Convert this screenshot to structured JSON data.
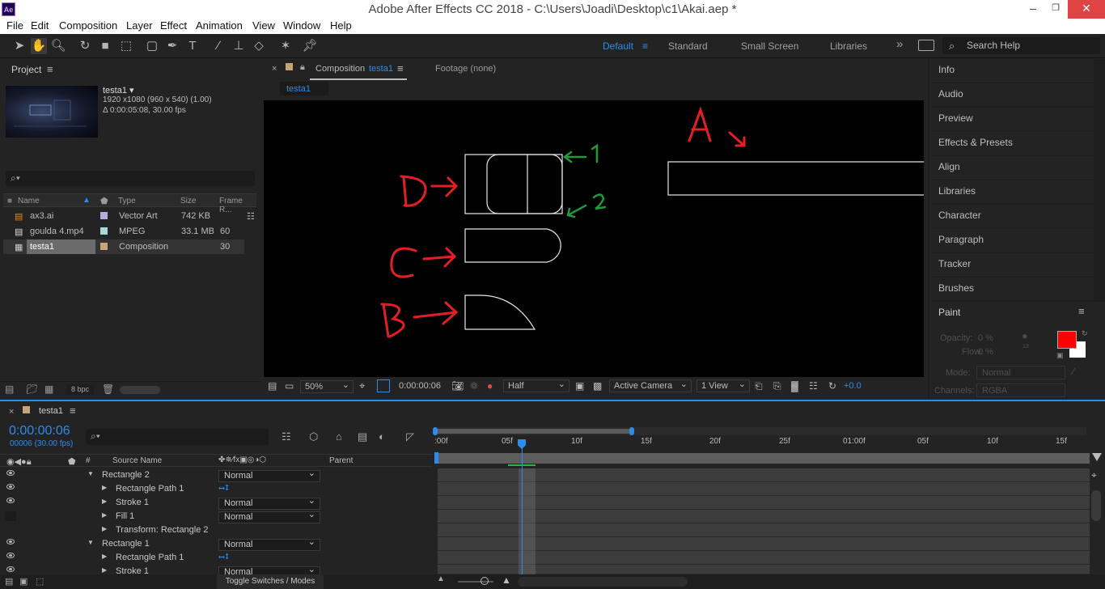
{
  "window": {
    "title": "Adobe After Effects CC 2018 - C:\\Users\\Joadi\\Desktop\\c1\\Akai.aep *",
    "app_icon": "Ae",
    "minimize": "–",
    "maximize": "❐",
    "close": "✕"
  },
  "menu": [
    "File",
    "Edit",
    "Composition",
    "Layer",
    "Effect",
    "Animation",
    "View",
    "Window",
    "Help"
  ],
  "workspaces": {
    "default": "Default",
    "standard": "Standard",
    "small": "Small Screen",
    "libraries": "Libraries",
    "more": "»"
  },
  "search_help": "Search Help",
  "project": {
    "title": "Project",
    "item_name": "testa1 ▾",
    "item_res": "1920 x1080  (960 x 540) (1.00)",
    "item_dur": "Δ 0:00:05:08, 30.00 fps",
    "columns": {
      "name": "Name",
      "type": "Type",
      "size": "Size",
      "frame": "Frame R..."
    },
    "rows": [
      {
        "name": "ax3.ai",
        "type": "Vector Art",
        "size": "742 KB",
        "frame": ""
      },
      {
        "name": "goulda 4.mp4",
        "type": "MPEG",
        "size": "33.1 MB",
        "frame": "60"
      },
      {
        "name": "testa1",
        "type": "Composition",
        "size": "",
        "frame": "30"
      }
    ],
    "bpc": "8 bpc"
  },
  "comp": {
    "tab_label": "Composition",
    "tab_name": "testa1",
    "footage_tab": "Footage  (none)",
    "breadcrumb": "testa1"
  },
  "viewer_controls": {
    "zoom": "50%",
    "time": "0:00:00:06",
    "resolution": "Half",
    "camera": "Active Camera",
    "views": "1 View",
    "exposure": "+0.0"
  },
  "annotations": {
    "A": "A",
    "B": "B",
    "C": "C",
    "D": "D",
    "one": "1",
    "two": "2"
  },
  "right_panels": [
    "Info",
    "Audio",
    "Preview",
    "Effects & Presets",
    "Align",
    "Libraries",
    "Character",
    "Paragraph",
    "Tracker",
    "Brushes"
  ],
  "paint": {
    "title": "Paint",
    "opacity_label": "Opacity:",
    "opacity_val": "0 %",
    "flow_label": "Flow:",
    "flow_val": "0 %",
    "mode_label": "Mode:",
    "mode_val": "Normal",
    "channels_label": "Channels:",
    "channels_val": "RGBA",
    "fg_color": "#ff0000",
    "bg_color": "#ffffff",
    "brush_size": "13"
  },
  "timeline": {
    "tab": "testa1",
    "timecode": "0:00:00:06",
    "timecode_sub": "00006 (30.00 fps)",
    "col_source": "Source Name",
    "col_parent": "Parent",
    "col_hash": "#",
    "ruler": [
      ":00f",
      "05f",
      "10f",
      "15f",
      "20f",
      "25f",
      "01:00f",
      "05f",
      "10f",
      "15f"
    ],
    "toggle": "Toggle Switches / Modes",
    "layers": [
      {
        "name": "Rectangle 2",
        "mode": "Normal",
        "indent": 1,
        "expand": "▼",
        "eye": true
      },
      {
        "name": "Rectangle Path 1",
        "mode": "",
        "indent": 2,
        "expand": "▶",
        "eye": true,
        "switch": true
      },
      {
        "name": "Stroke 1",
        "mode": "Normal",
        "indent": 2,
        "expand": "▶",
        "eye": true
      },
      {
        "name": "Fill 1",
        "mode": "Normal",
        "indent": 2,
        "expand": "▶",
        "eye": false
      },
      {
        "name": "Transform: Rectangle 2",
        "mode": "",
        "indent": 2,
        "expand": "▶",
        "eye": false
      },
      {
        "name": "Rectangle 1",
        "mode": "Normal",
        "indent": 1,
        "expand": "▼",
        "eye": true
      },
      {
        "name": "Rectangle Path 1",
        "mode": "",
        "indent": 2,
        "expand": "▶",
        "eye": true,
        "switch": true
      },
      {
        "name": "Stroke 1",
        "mode": "Normal",
        "indent": 2,
        "expand": "▶",
        "eye": true
      }
    ]
  }
}
